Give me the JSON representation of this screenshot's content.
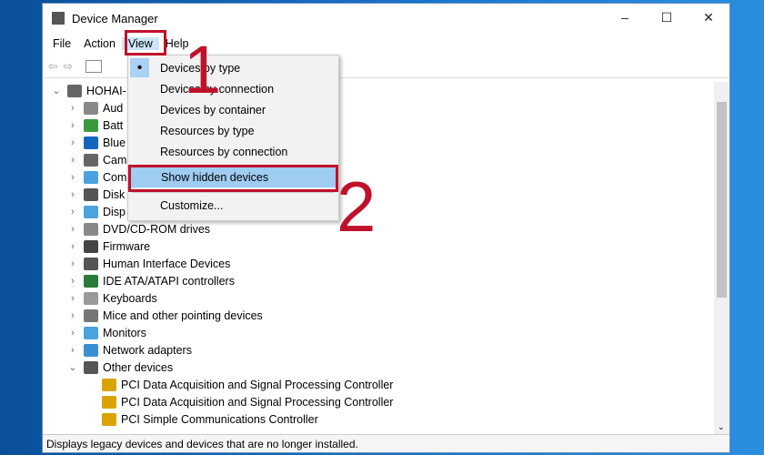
{
  "window": {
    "title": "Device Manager",
    "controls": [
      "–",
      "☐",
      "✕"
    ]
  },
  "menubar": [
    "File",
    "Action",
    "View",
    "Help"
  ],
  "view_menu": {
    "items": [
      "Devices by type",
      "Devices by connection",
      "Devices by container",
      "Resources by type",
      "Resources by connection",
      "Show hidden devices",
      "Customize..."
    ],
    "checked": "Devices by type",
    "highlighted": "Show hidden devices"
  },
  "tree": {
    "root": "HOHAI-",
    "categories": [
      {
        "label": "Aud",
        "icon": "speaker-icon",
        "color": "#888"
      },
      {
        "label": "Batt",
        "icon": "battery-icon",
        "color": "#3a9a3a"
      },
      {
        "label": "Blue",
        "icon": "bluetooth-icon",
        "color": "#1565c0"
      },
      {
        "label": "Cam",
        "icon": "camera-icon",
        "color": "#666"
      },
      {
        "label": "Com",
        "icon": "computer-icon",
        "color": "#4aa3df"
      },
      {
        "label": "Disk",
        "icon": "disk-icon",
        "color": "#555"
      },
      {
        "label": "Disp",
        "icon": "display-icon",
        "color": "#4aa3df"
      },
      {
        "label": "DVD/CD-ROM drives",
        "icon": "dvd-icon",
        "color": "#888"
      },
      {
        "label": "Firmware",
        "icon": "firmware-icon",
        "color": "#444"
      },
      {
        "label": "Human Interface Devices",
        "icon": "hid-icon",
        "color": "#555"
      },
      {
        "label": "IDE ATA/ATAPI controllers",
        "icon": "ide-icon",
        "color": "#2a7a3a"
      },
      {
        "label": "Keyboards",
        "icon": "keyboard-icon",
        "color": "#999"
      },
      {
        "label": "Mice and other pointing devices",
        "icon": "mouse-icon",
        "color": "#777"
      },
      {
        "label": "Monitors",
        "icon": "monitor-icon",
        "color": "#4aa3df"
      },
      {
        "label": "Network adapters",
        "icon": "network-icon",
        "color": "#3a8fd0"
      }
    ],
    "expanded": {
      "label": "Other devices",
      "children": [
        "PCI Data Acquisition and Signal Processing Controller",
        "PCI Data Acquisition and Signal Processing Controller",
        "PCI Simple Communications Controller"
      ]
    }
  },
  "status": "Displays legacy devices and devices that are no longer installed.",
  "annotations": {
    "step1": "1",
    "step2": "2",
    "color": "#c0112b"
  }
}
